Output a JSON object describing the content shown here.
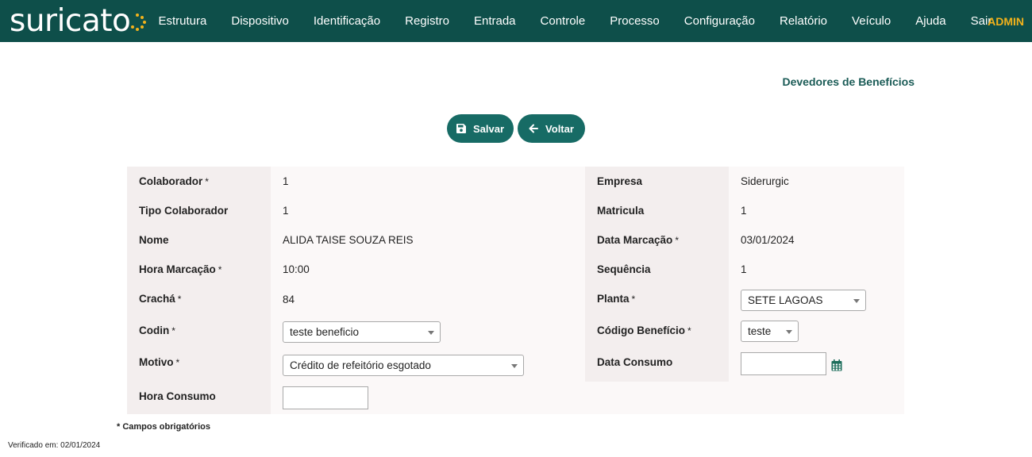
{
  "brand": {
    "name": "suricato",
    "accent": "#f2b21b",
    "navbar_bg": "#0e4f4a"
  },
  "menu": [
    {
      "label": "Estrutura"
    },
    {
      "label": "Dispositivo"
    },
    {
      "label": "Identificação"
    },
    {
      "label": "Registro"
    },
    {
      "label": "Entrada"
    },
    {
      "label": "Controle"
    },
    {
      "label": "Processo"
    },
    {
      "label": "Configuração"
    },
    {
      "label": "Relatório"
    },
    {
      "label": "Veículo"
    },
    {
      "label": "Ajuda"
    },
    {
      "label": "Sair"
    }
  ],
  "user": "ADMIN",
  "page_title": "Devedores de Benefícios",
  "actions": {
    "save_label": "Salvar",
    "save_icon": "floppy-disk-icon",
    "back_label": "Voltar",
    "back_icon": "arrow-left-icon"
  },
  "form": {
    "required_mark": "*",
    "colaborador": {
      "label": "Colaborador",
      "value": "1"
    },
    "tipo_colaborador": {
      "label": "Tipo Colaborador",
      "value": "1"
    },
    "nome": {
      "label": "Nome",
      "value": "ALIDA TAISE SOUZA REIS"
    },
    "hora_marcacao": {
      "label": "Hora Marcação",
      "value": "10:00"
    },
    "cracha": {
      "label": "Crachá",
      "value": "84"
    },
    "codin": {
      "label": "Codin",
      "value": "teste beneficio"
    },
    "motivo": {
      "label": "Motivo",
      "value": "Crédito de refeitório esgotado"
    },
    "hora_consumo": {
      "label": "Hora Consumo",
      "value": ""
    },
    "empresa": {
      "label": "Empresa",
      "value": "Siderurgic"
    },
    "matricula": {
      "label": "Matricula",
      "value": "1"
    },
    "data_marcacao": {
      "label": "Data Marcação",
      "value": "03/01/2024"
    },
    "sequencia": {
      "label": "Sequência",
      "value": "1"
    },
    "planta": {
      "label": "Planta",
      "value": "SETE LAGOAS"
    },
    "codigo_beneficio": {
      "label": "Código Benefício",
      "value": "teste"
    },
    "data_consumo": {
      "label": "Data Consumo",
      "value": "",
      "icon": "calendar-icon"
    }
  },
  "footnote": "* Campos obrigatórios",
  "verified": "Verificado em: 02/01/2024"
}
